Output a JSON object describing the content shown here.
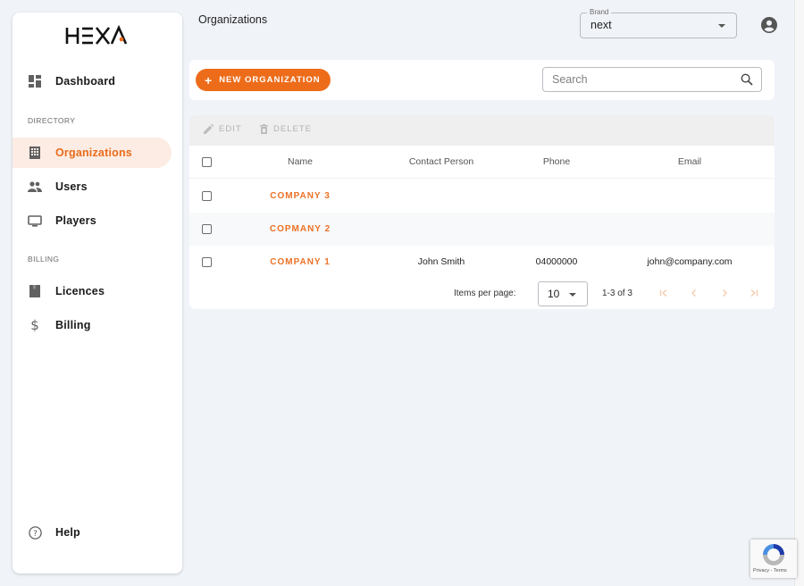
{
  "brand": {
    "logo_text": "HEXA",
    "accent_color": "#ed6c1a"
  },
  "sidebar": {
    "items": [
      {
        "label": "Dashboard",
        "icon": "dashboard-icon",
        "active": false
      },
      {
        "label": "Organizations",
        "icon": "building-icon",
        "active": true
      },
      {
        "label": "Users",
        "icon": "users-icon",
        "active": false
      },
      {
        "label": "Players",
        "icon": "monitor-icon",
        "active": false
      },
      {
        "label": "Licences",
        "icon": "book-icon",
        "active": false
      },
      {
        "label": "Billing",
        "icon": "dollar-icon",
        "active": false
      },
      {
        "label": "Help",
        "icon": "help-icon",
        "active": false
      }
    ],
    "sections": {
      "directory": "DIRECTORY",
      "billing": "BILLING"
    }
  },
  "header": {
    "title": "Organizations",
    "brand_select": {
      "label": "Brand",
      "value": "next"
    },
    "account_icon": "account-circle-icon"
  },
  "toolbar": {
    "new_button_label": "NEW ORGANIZATION",
    "search_placeholder": "Search",
    "search_value": ""
  },
  "table": {
    "actions": {
      "edit": "EDIT",
      "delete": "DELETE"
    },
    "columns": [
      "Name",
      "Contact Person",
      "Phone",
      "Email"
    ],
    "rows": [
      {
        "name": "COMPANY 3",
        "contact": "",
        "phone": "",
        "email": ""
      },
      {
        "name": "COPMANY 2",
        "contact": "",
        "phone": "",
        "email": ""
      },
      {
        "name": "COMPANY 1",
        "contact": "John Smith",
        "phone": "04000000",
        "email": "john@company.com"
      }
    ]
  },
  "pagination": {
    "items_per_page_label": "Items per page:",
    "items_per_page_value": "10",
    "range_label": "1-3 of 3"
  },
  "recaptcha": {
    "links": "Privacy - Terms"
  }
}
